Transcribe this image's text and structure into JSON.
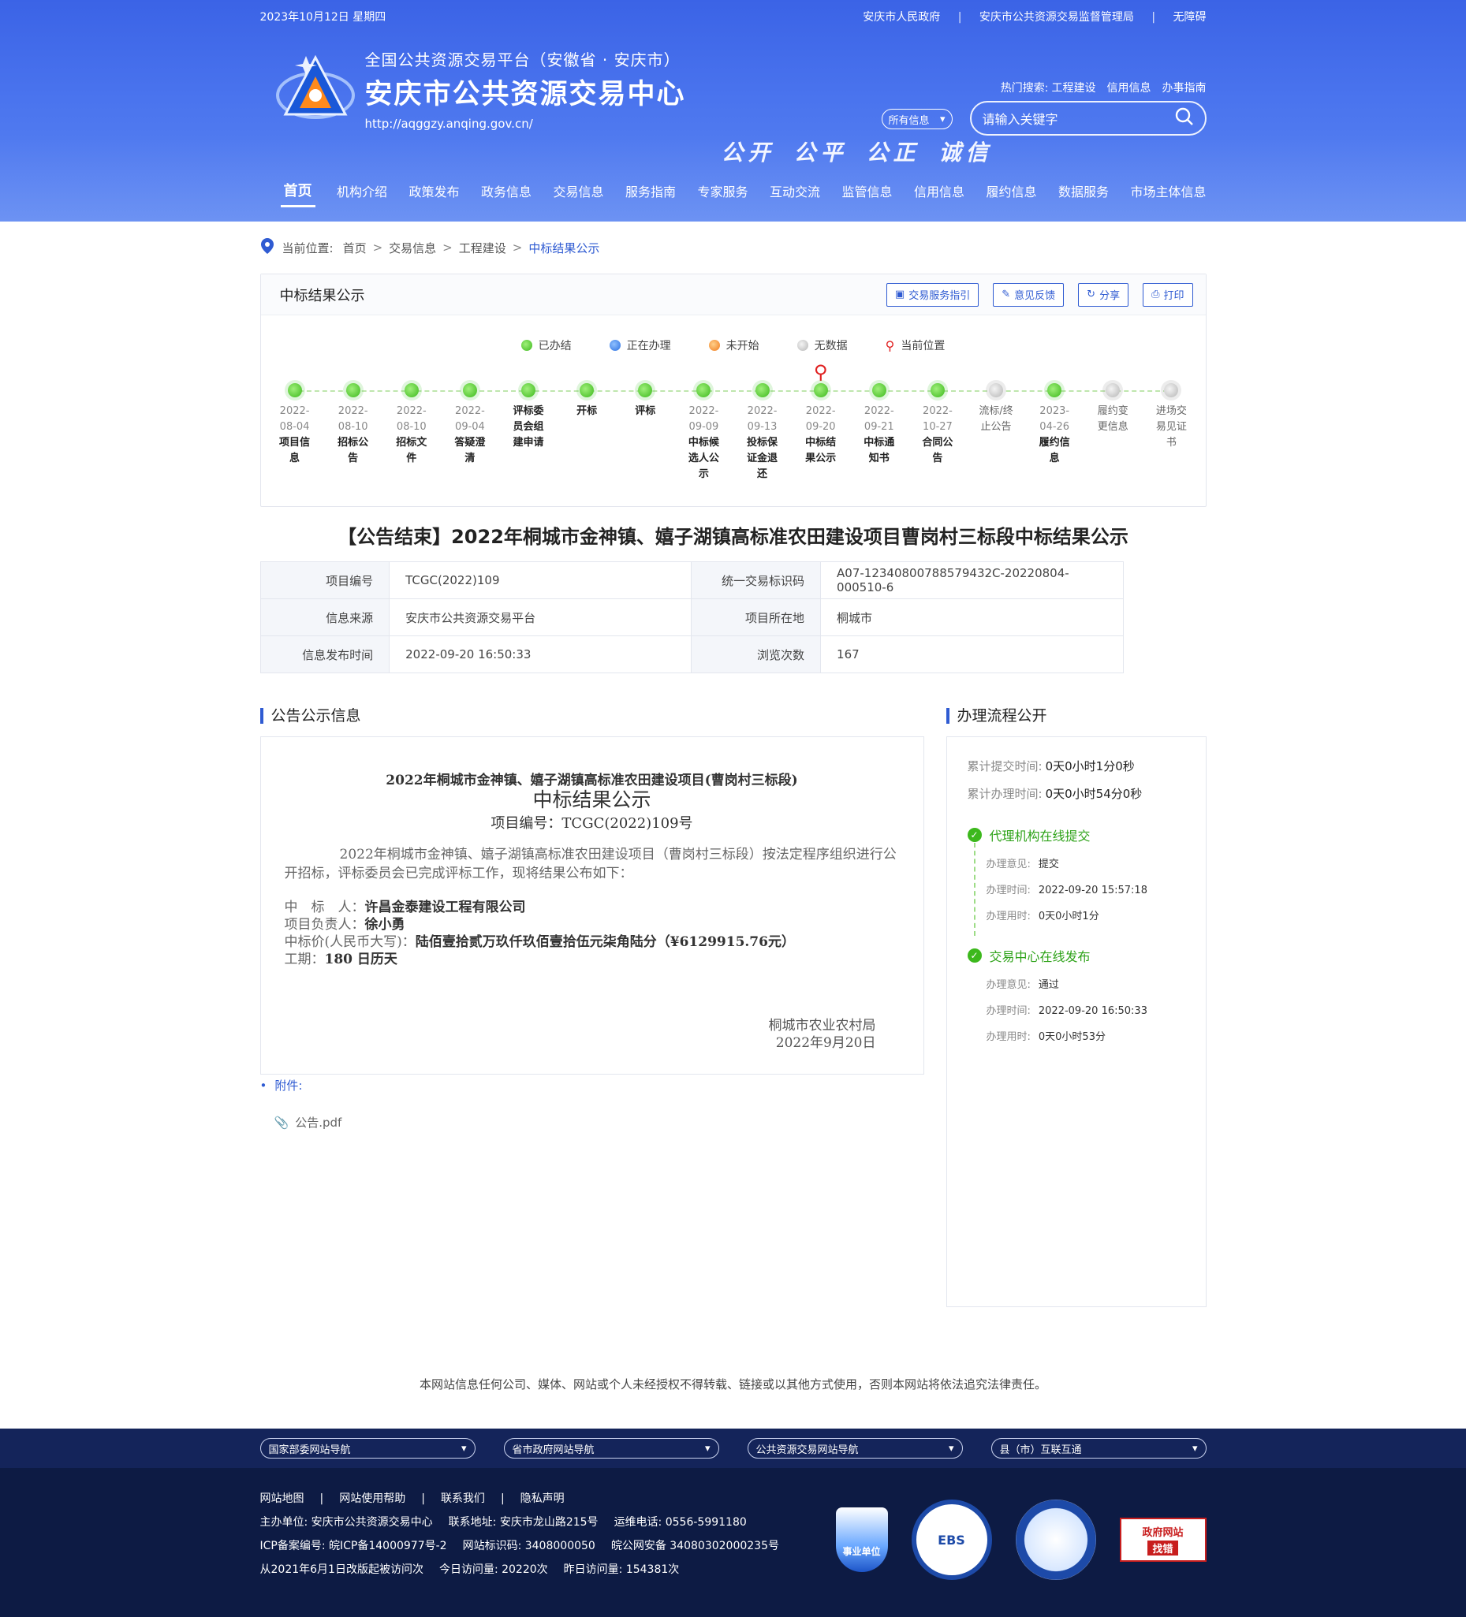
{
  "header": {
    "date": "2023年10月12日 星期四",
    "top_links": [
      "安庆市人民政府",
      "安庆市公共资源交易监督管理局",
      "无障碍"
    ],
    "top_sep": "|",
    "platform": "全国公共资源交易平台（安徽省 · 安庆市）",
    "site_name": "安庆市公共资源交易中心",
    "url": "http://aqggzy.anqing.gov.cn/",
    "slogan": [
      "公开",
      "公平",
      "公正",
      "诚信"
    ],
    "hot_label": "热门搜索:",
    "hot_items": [
      "工程建设",
      "信用信息",
      "办事指南"
    ],
    "search_scope": "所有信息",
    "search_placeholder": "请输入关键字",
    "nav": [
      "首页",
      "机构介绍",
      "政策发布",
      "政务信息",
      "交易信息",
      "服务指南",
      "专家服务",
      "互动交流",
      "监管信息",
      "信用信息",
      "履约信息",
      "数据服务",
      "市场主体信息"
    ]
  },
  "breadcrumb": {
    "label": "当前位置:",
    "items": [
      "首页",
      "交易信息",
      "工程建设"
    ],
    "current": "中标结果公示",
    "sep": ">"
  },
  "progress_panel": {
    "title": "中标结果公示",
    "tools": [
      "交易服务指引",
      "意见反馈",
      "分享",
      "打印"
    ],
    "legend": [
      "已办结",
      "正在办理",
      "未开始",
      "无数据",
      "当前位置"
    ],
    "steps": [
      {
        "date": "2022-08-04",
        "name": "项目信息",
        "status": "done"
      },
      {
        "date": "2022-08-10",
        "name": "招标公告",
        "status": "done"
      },
      {
        "date": "2022-08-10",
        "name": "招标文件",
        "status": "done"
      },
      {
        "date": "2022-09-04",
        "name": "答疑澄清",
        "status": "done"
      },
      {
        "date": "",
        "name": "评标委员会组建申请",
        "status": "done"
      },
      {
        "date": "",
        "name": "开标",
        "status": "done"
      },
      {
        "date": "",
        "name": "评标",
        "status": "done"
      },
      {
        "date": "2022-09-09",
        "name": "中标候选人公示",
        "status": "done"
      },
      {
        "date": "2022-09-13",
        "name": "投标保证金退还",
        "status": "done"
      },
      {
        "date": "2022-09-20",
        "name": "中标结果公示",
        "status": "done",
        "current": true
      },
      {
        "date": "2022-09-21",
        "name": "中标通知书",
        "status": "done"
      },
      {
        "date": "2022-10-27",
        "name": "合同公告",
        "status": "done"
      },
      {
        "date": "",
        "name": "流标/终止公告",
        "status": "nodata"
      },
      {
        "date": "2023-04-26",
        "name": "履约信息",
        "status": "done"
      },
      {
        "date": "",
        "name": "履约变更信息",
        "status": "nodata"
      },
      {
        "date": "",
        "name": "进场交易见证书",
        "status": "nodata"
      }
    ]
  },
  "notice_title": "【公告结束】2022年桐城市金神镇、嬉子湖镇高标准农田建设项目曹岗村三标段中标结果公示",
  "info_table": [
    [
      "项目编号",
      "TCGC(2022)109",
      "统一交易标识码",
      "A07-12340800788579432C-20220804-000510-6"
    ],
    [
      "信息来源",
      "安庆市公共资源交易平台",
      "项目所在地",
      "桐城市"
    ],
    [
      "信息发布时间",
      "2022-09-20 16:50:33",
      "浏览次数",
      "167"
    ]
  ],
  "announcement": {
    "section_title": "公告公示信息",
    "title1": "2022年桐城市金神镇、嬉子湖镇高标准农田建设项目(曹岗村三标段)",
    "title2": "中标结果公示",
    "title3": "项目编号：TCGC(2022)109号",
    "para": "2022年桐城市金神镇、嬉子湖镇高标准农田建设项目（曹岗村三标段）按法定程序组织进行公开招标，评标委员会已完成评标工作，现将结果公布如下：",
    "lines": [
      {
        "k": "中　标　人：",
        "v": "许昌金泰建设工程有限公司"
      },
      {
        "k": "项目负责人：",
        "v": "徐小勇"
      },
      {
        "k": "中标价(人民币大写)：",
        "v": "陆佰壹拾贰万玖仟玖佰壹拾伍元柒角陆分（¥6129915.76元）"
      },
      {
        "k": "工期：",
        "v": "180 日历天"
      }
    ],
    "sign_org": "桐城市农业农村局",
    "sign_date": "2022年9月20日"
  },
  "flow": {
    "section_title": "办理流程公开",
    "total_submit_label": "累计提交时间:",
    "total_submit": "0天0小时1分0秒",
    "total_handle_label": "累计办理时间:",
    "total_handle": "0天0小时54分0秒",
    "steps": [
      {
        "title": "代理机构在线提交",
        "opinion_label": "办理意见:",
        "opinion": "提交",
        "time_label": "办理时间:",
        "time": "2022-09-20 15:57:18",
        "used_label": "办理用时:",
        "used": "0天0小时1分"
      },
      {
        "title": "交易中心在线发布",
        "opinion_label": "办理意见:",
        "opinion": "通过",
        "time_label": "办理时间:",
        "time": "2022-09-20 16:50:33",
        "used_label": "办理用时:",
        "used": "0天0小时53分"
      }
    ]
  },
  "attachment": {
    "label": "附件:",
    "file": "公告.pdf"
  },
  "copyright_notice": "本网站信息任何公司、媒体、网站或个人未经授权不得转载、链接或以其他方式使用，否则本网站将依法追究法律责任。",
  "footer": {
    "selects": [
      "国家部委网站导航",
      "省市政府网站导航",
      "公共资源交易网站导航",
      "县（市）互联互通"
    ],
    "links": [
      "网站地图",
      "网站使用帮助",
      "联系我们",
      "隐私声明"
    ],
    "sep": "|",
    "row2": [
      "主办单位: 安庆市公共资源交易中心",
      "联系地址: 安庆市龙山路215号",
      "运维电话: 0556-5991180"
    ],
    "row3": [
      "ICP备案编号: 皖ICP备14000977号-2",
      "网站标识码: 3408000050",
      "皖公网安备 34080302000235号"
    ],
    "row4": [
      "从2021年6月1日改版起被访问次",
      "今日访问量: 20220次",
      "昨日访问量: 154381次"
    ],
    "badges": [
      "事业单位",
      "EBS",
      "",
      "政府网站",
      "找错"
    ]
  },
  "colors": {
    "primary": "#2f5bd2",
    "header": "#4a74ee",
    "done": "#3cb81c",
    "footer": "#0d1b44"
  }
}
